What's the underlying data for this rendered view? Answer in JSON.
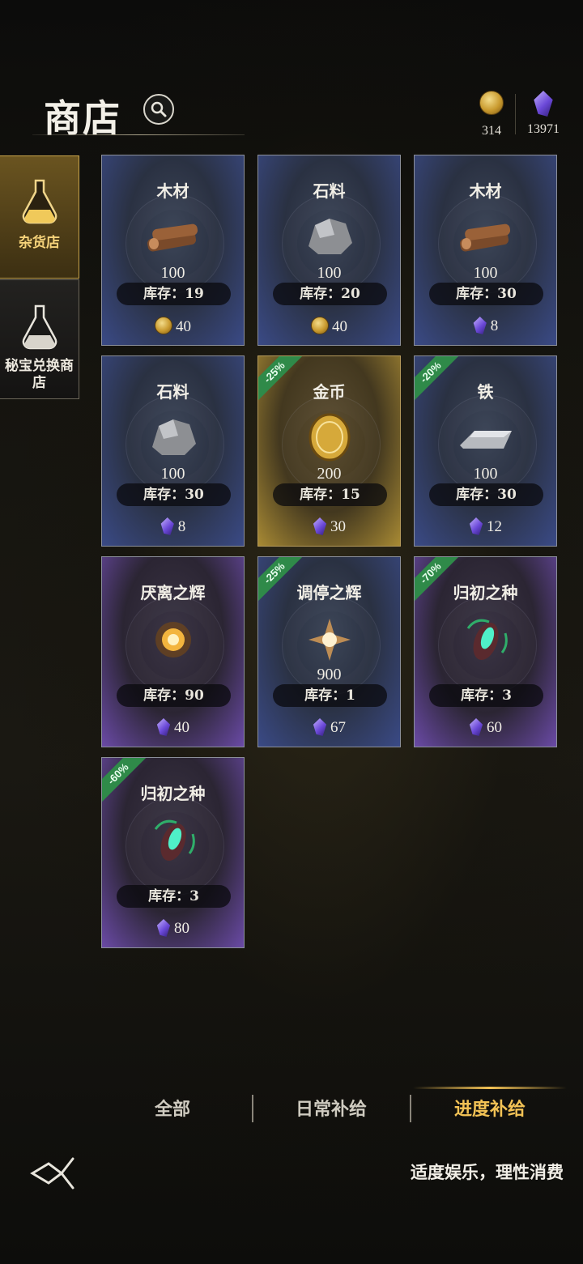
{
  "header": {
    "title": "商店"
  },
  "currencies": [
    {
      "icon": "gold-coin-icon",
      "value": "314"
    },
    {
      "icon": "purple-gem-icon",
      "value": "13971"
    }
  ],
  "sidebar": {
    "items": [
      {
        "label": "杂货店",
        "active": true
      },
      {
        "label": "秘宝兑换商店",
        "active": false
      }
    ]
  },
  "items": [
    {
      "name": "木材",
      "qty": "100",
      "stock": "库存：19",
      "price": "40",
      "currency": "coin",
      "discount": "",
      "theme": "blue",
      "icon": "wood-logs-icon"
    },
    {
      "name": "石料",
      "qty": "100",
      "stock": "库存：20",
      "price": "40",
      "currency": "coin",
      "discount": "",
      "theme": "blue",
      "icon": "stone-icon"
    },
    {
      "name": "木材",
      "qty": "100",
      "stock": "库存：30",
      "price": "8",
      "currency": "gem",
      "discount": "",
      "theme": "blue",
      "icon": "wood-logs-icon"
    },
    {
      "name": "石料",
      "qty": "100",
      "stock": "库存：30",
      "price": "8",
      "currency": "gem",
      "discount": "",
      "theme": "blue",
      "icon": "stone-icon"
    },
    {
      "name": "金币",
      "qty": "200",
      "stock": "库存：15",
      "price": "30",
      "currency": "gem",
      "discount": "-25%",
      "theme": "gold",
      "icon": "gold-coin-icon"
    },
    {
      "name": "铁",
      "qty": "100",
      "stock": "库存：30",
      "price": "12",
      "currency": "gem",
      "discount": "-20%",
      "theme": "blue",
      "icon": "iron-ingot-icon"
    },
    {
      "name": "厌离之辉",
      "qty": "",
      "stock": "库存：90",
      "price": "40",
      "currency": "gem",
      "discount": "",
      "theme": "purple",
      "icon": "golden-orb-icon"
    },
    {
      "name": "调停之辉",
      "qty": "900",
      "stock": "库存：1",
      "price": "67",
      "currency": "gem",
      "discount": "-25%",
      "theme": "blue",
      "icon": "light-orb-icon"
    },
    {
      "name": "归初之种",
      "qty": "",
      "stock": "库存：3",
      "price": "60",
      "currency": "gem",
      "discount": "-70%",
      "theme": "purple",
      "icon": "seed-crystal-icon"
    },
    {
      "name": "归初之种",
      "qty": "",
      "stock": "库存：3",
      "price": "80",
      "currency": "gem",
      "discount": "-60%",
      "theme": "purple",
      "icon": "seed-crystal-icon"
    }
  ],
  "tabs": [
    {
      "label": "全部",
      "active": false
    },
    {
      "label": "日常补给",
      "active": false
    },
    {
      "label": "进度补给",
      "active": true
    }
  ],
  "footer": {
    "notice": "适度娱乐，理性消费"
  },
  "colors": {
    "accent": "#f2c255",
    "discount": "#2f8a49",
    "card_blue": "#3a4a86",
    "card_purple": "#6a4aa6",
    "card_gold": "#a88a34"
  }
}
